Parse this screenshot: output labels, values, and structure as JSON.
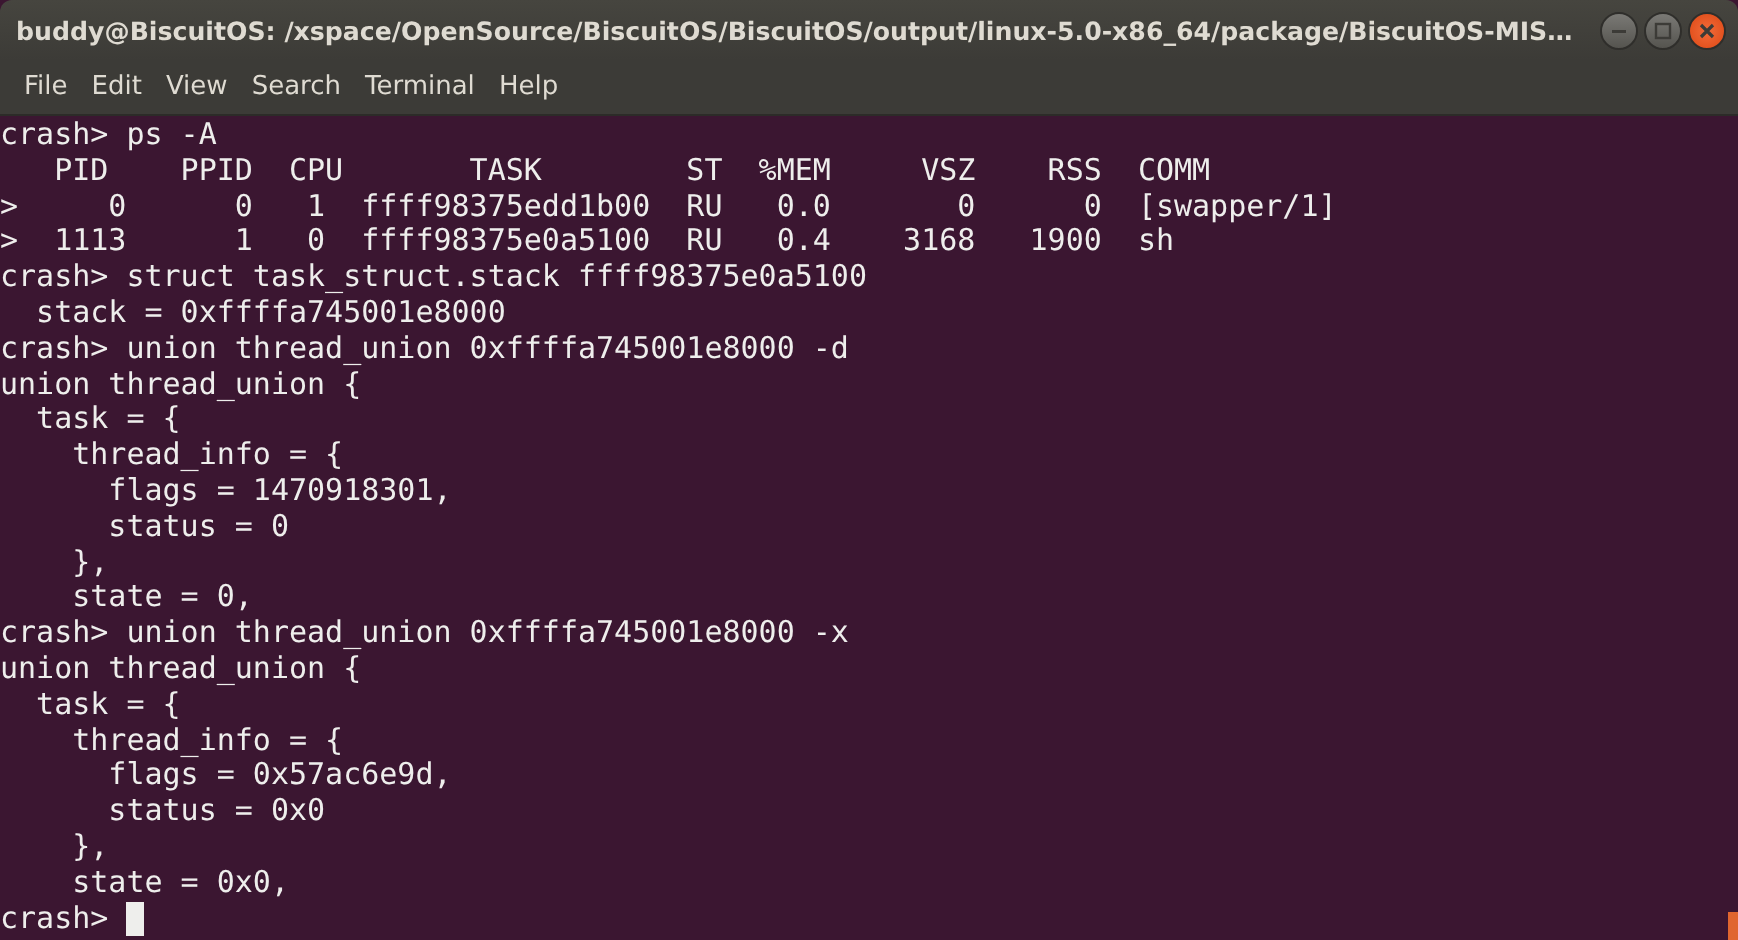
{
  "window": {
    "title": "buddy@BiscuitOS: /xspace/OpenSource/BiscuitOS/BiscuitOS/output/linux-5.0-x86_64/package/BiscuitOS-MIS…"
  },
  "menu": [
    "File",
    "Edit",
    "View",
    "Search",
    "Terminal",
    "Help"
  ],
  "terminal": {
    "lines": [
      "crash> ps -A",
      "   PID    PPID  CPU       TASK        ST  %MEM     VSZ    RSS  COMM",
      ">     0      0   1  ffff98375edd1b00  RU   0.0       0      0  [swapper/1]",
      ">  1113      1   0  ffff98375e0a5100  RU   0.4    3168   1900  sh",
      "crash> struct task_struct.stack ffff98375e0a5100",
      "  stack = 0xffffa745001e8000",
      "crash> union thread_union 0xffffa745001e8000 -d",
      "union thread_union {",
      "  task = {",
      "    thread_info = {",
      "      flags = 1470918301,",
      "      status = 0",
      "    },",
      "    state = 0,",
      "crash> union thread_union 0xffffa745001e8000 -x",
      "union thread_union {",
      "  task = {",
      "    thread_info = {",
      "      flags = 0x57ac6e9d,",
      "      status = 0x0",
      "    },",
      "    state = 0x0,"
    ],
    "prompt": "crash>"
  }
}
